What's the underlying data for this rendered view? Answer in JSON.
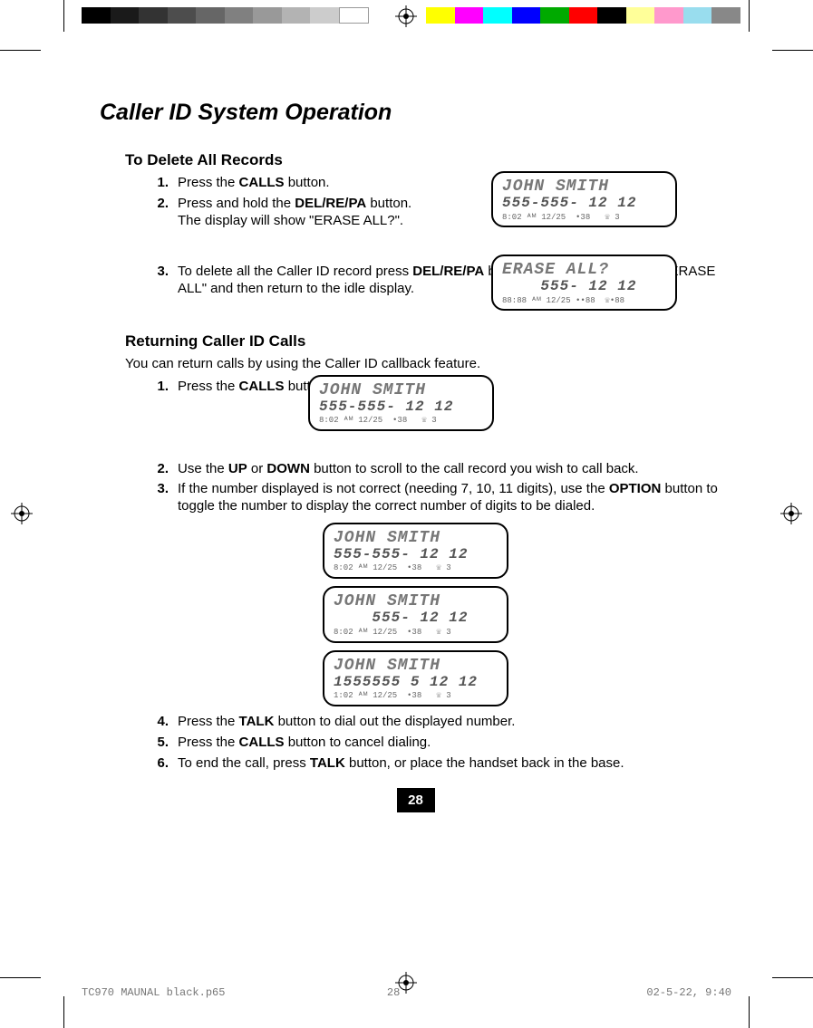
{
  "title": "Caller ID System Operation",
  "delete": {
    "heading": "To Delete All Records",
    "steps": {
      "1": {
        "n": "1.",
        "pre": "Press the ",
        "b": "CALLS",
        "post": " button."
      },
      "2": {
        "n": "2.",
        "pre": "Press and hold the ",
        "b": "DEL/RE/PA",
        "post": " button. The display will show \"ERASE ALL?\"."
      },
      "3": {
        "n": "3.",
        "pre": "To delete all the Caller ID record press ",
        "b": "DEL/RE/PA",
        "post": " button. The display will show \"ERASE ALL\" and then return to the idle display."
      }
    }
  },
  "returning": {
    "heading": "Returning Caller ID Calls",
    "intro": "You can return calls by using the Caller ID callback feature.",
    "steps": {
      "1": {
        "n": "1.",
        "pre": "Press the ",
        "b": "CALLS",
        "post": " button."
      },
      "2": {
        "n": "2.",
        "pre": "Use the ",
        "b1": "UP",
        "mid": " or ",
        "b2": "DOWN",
        "post": " button to scroll to the call record you wish to call back."
      },
      "3": {
        "n": "3.",
        "pre": "If the number displayed is not correct (needing 7, 10, 11 digits), use the ",
        "b": "OPTION",
        "post": " button to toggle the number to display the correct number of digits to be dialed."
      },
      "4": {
        "n": "4.",
        "pre": "Press the ",
        "b": "TALK",
        "post": " button to dial out the displayed number."
      },
      "5": {
        "n": "5.",
        "pre": "Press the ",
        "b": "CALLS",
        "post": " button to cancel dialing."
      },
      "6": {
        "n": "6.",
        "pre": "To end the call, press ",
        "b": "TALK",
        "post": " button, or place the handset back in the base."
      }
    }
  },
  "lcd": {
    "a": {
      "l1": "JOHN SMITH",
      "l2": "555-555- 12 12",
      "l3": "8:02 ᴬᴹ 12/25  •38   ☏ 3"
    },
    "b": {
      "l1": "ERASE ALL?",
      "l2": "    555- 12 12",
      "l3": "88:88 ᴬᴹ 12/25 ••88  ☏•88"
    },
    "c": {
      "l1": "JOHN SMITH",
      "l2": "555-555- 12 12",
      "l3": "8:02 ᴬᴹ 12/25  •38   ☏ 3"
    },
    "d": {
      "l1": "JOHN SMITH",
      "l2": "555-555- 12 12",
      "l3": "8:02 ᴬᴹ 12/25  •38   ☏ 3"
    },
    "e": {
      "l1": "JOHN SMITH",
      "l2": "    555- 12 12",
      "l3": "8:02 ᴬᴹ 12/25  •38   ☏ 3"
    },
    "f": {
      "l1": "JOHN SMITH",
      "l2": "1555555 5 12 12",
      "l3": "1:02 ᴬᴹ 12/25  •38   ☏ 3"
    }
  },
  "page_number": "28",
  "footer": {
    "file": "TC970 MAUNAL black.p65",
    "page": "28",
    "date": "02-5-22, 9:40"
  },
  "colorbar": [
    "#000",
    "#1a1a1a",
    "#333",
    "#4d4d4d",
    "#666",
    "#808080",
    "#999",
    "#b3b3b3",
    "#ccc",
    "#fff",
    "",
    "",
    "#ff0",
    "#f0f",
    "#0ff",
    "#00f",
    "#0a0",
    "#f00",
    "#000",
    "#ff8",
    "#f8f",
    "#8ff",
    "#888"
  ]
}
